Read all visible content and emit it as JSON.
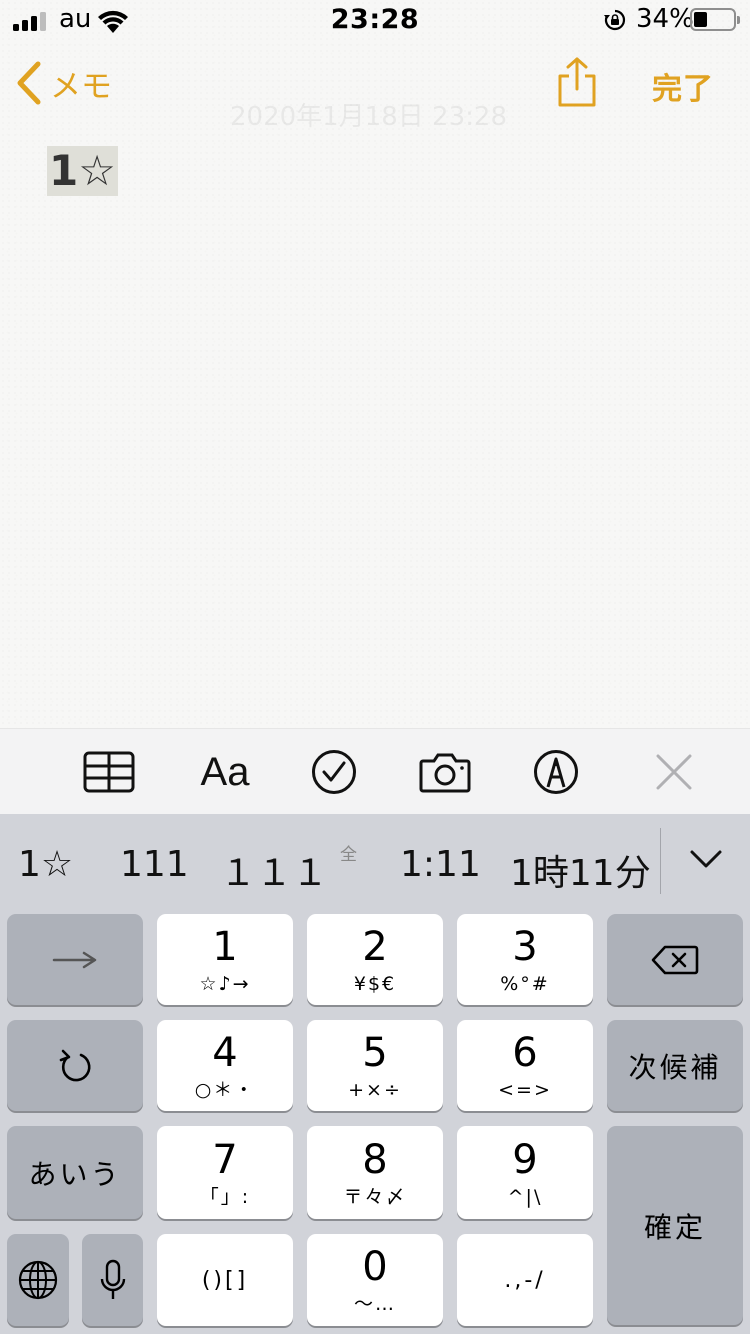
{
  "status_bar": {
    "carrier": "au",
    "time": "23:28",
    "battery_percent": "34%",
    "battery_level": 0.34
  },
  "nav": {
    "back_label": "メモ",
    "done_label": "完了",
    "faded_date": "2020年1月18日 23:28"
  },
  "note": {
    "text": "1☆"
  },
  "format_toolbar": {
    "items": [
      "table-icon",
      "Aa",
      "checklist-icon",
      "camera-icon",
      "markup-pen-icon",
      "close-icon"
    ],
    "text_style_label": "Aa"
  },
  "candidates": {
    "items": [
      "1☆",
      "111",
      "１１１",
      "1:11",
      "1時11分"
    ],
    "fullwidth_marker": "全"
  },
  "keyboard": {
    "keys": {
      "k1": {
        "main": "1",
        "sub": "☆♪→"
      },
      "k2": {
        "main": "2",
        "sub": "¥$€"
      },
      "k3": {
        "main": "3",
        "sub": "%°#"
      },
      "k4": {
        "main": "4",
        "sub": "○＊・"
      },
      "k5": {
        "main": "5",
        "sub": "+×÷"
      },
      "k6": {
        "main": "6",
        "sub": "<=>"
      },
      "k7": {
        "main": "7",
        "sub": "「」:"
      },
      "k8": {
        "main": "8",
        "sub": "〒々〆"
      },
      "k9": {
        "main": "9",
        "sub": "^|\\"
      },
      "k0": {
        "main": "0",
        "sub": "〜…"
      },
      "paren": "()[]",
      "punct": ".,-/"
    },
    "next_candidate": "次候補",
    "kana_mode": "あいう",
    "confirm": "確定"
  },
  "colors": {
    "accent": "#e0a221",
    "keyboard_bg": "#d1d3d9",
    "dark_key": "#adb1b9"
  }
}
